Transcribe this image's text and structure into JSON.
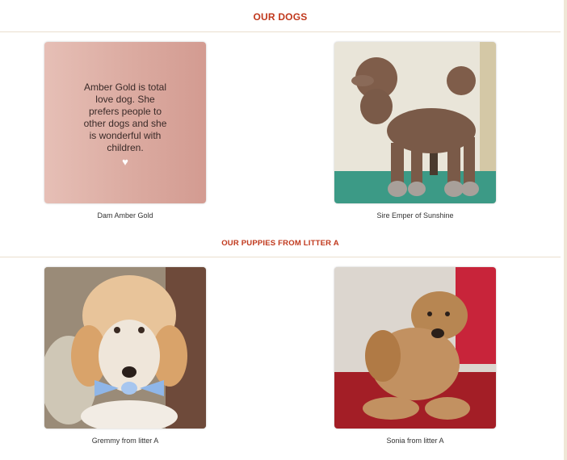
{
  "header": {
    "title": "OUR DOGS"
  },
  "dogs": [
    {
      "caption": "Dam Amber Gold",
      "text": "Amber Gold is total love dog. She prefers people to other dogs and she is wonderful with children.",
      "icon": "heart-icon"
    },
    {
      "caption": "Sire Emper of Sunshine"
    }
  ],
  "puppies": {
    "title": "OUR PUPPIES FROM LITTER A",
    "items": [
      {
        "caption": "Gremmy from litter A"
      },
      {
        "caption": "Sonia from litter A"
      }
    ]
  },
  "colors": {
    "accent": "#c0381c",
    "divider": "#eadfce"
  }
}
